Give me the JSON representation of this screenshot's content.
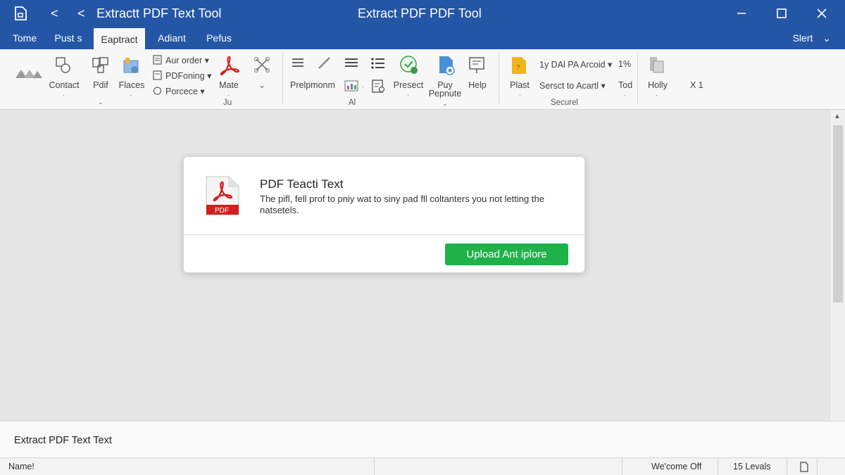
{
  "window": {
    "doc_title": "Extractt PDF Text Tool",
    "app_title": "Extract PDF PDF Tool",
    "back_glyph": "<",
    "forward_glyph": "<"
  },
  "tabs": [
    {
      "label": "Tome"
    },
    {
      "label": "Pust s"
    },
    {
      "label": "Eaptract"
    },
    {
      "label": "Adiant"
    },
    {
      "label": "Pefus"
    }
  ],
  "tab_right": {
    "label": "Slert",
    "caret": "⌄"
  },
  "ribbon": {
    "contact": "Contact",
    "pdf": "Pdif",
    "flaces": "Flaces",
    "aut_order": "Aur order",
    "pdfoning": "PDFoning",
    "porcece": "Porcece",
    "mate": "Mate",
    "group_ju": "Ju",
    "prelpmonm": "Prelpmonm",
    "group_al": "Al",
    "presect": "Presect",
    "puy": "Puy",
    "pepnute": "Pepnute",
    "help": "Help",
    "plast": "Plast",
    "font_select": "1y DAl PA Arcoid",
    "percent": "1%",
    "sersct": "Sersct to Acartl",
    "tod": "Tod",
    "group_securel": "Securel",
    "holly": "Holly",
    "x1": "X 1"
  },
  "card": {
    "title": "PDF Teacti Text",
    "description": "The pifl, fell prof to pniy wat to siny pad fll coltanters you not letting the natsetels.",
    "button": "Upload Ant iplore"
  },
  "bottom_panel": {
    "text": "Extract PDF Text Text"
  },
  "status": {
    "name": "Name!",
    "welcome": "We'come Off",
    "levels": "15 Levals"
  },
  "colors": {
    "titlebar": "#2456a6",
    "upload_button": "#1fb14a",
    "pdf_red": "#d3201f"
  },
  "icons": [
    "document-icon",
    "back-icon",
    "forward-icon",
    "minimize-icon",
    "maximize-icon",
    "close-icon",
    "pdf-file-icon",
    "page-icon"
  ]
}
